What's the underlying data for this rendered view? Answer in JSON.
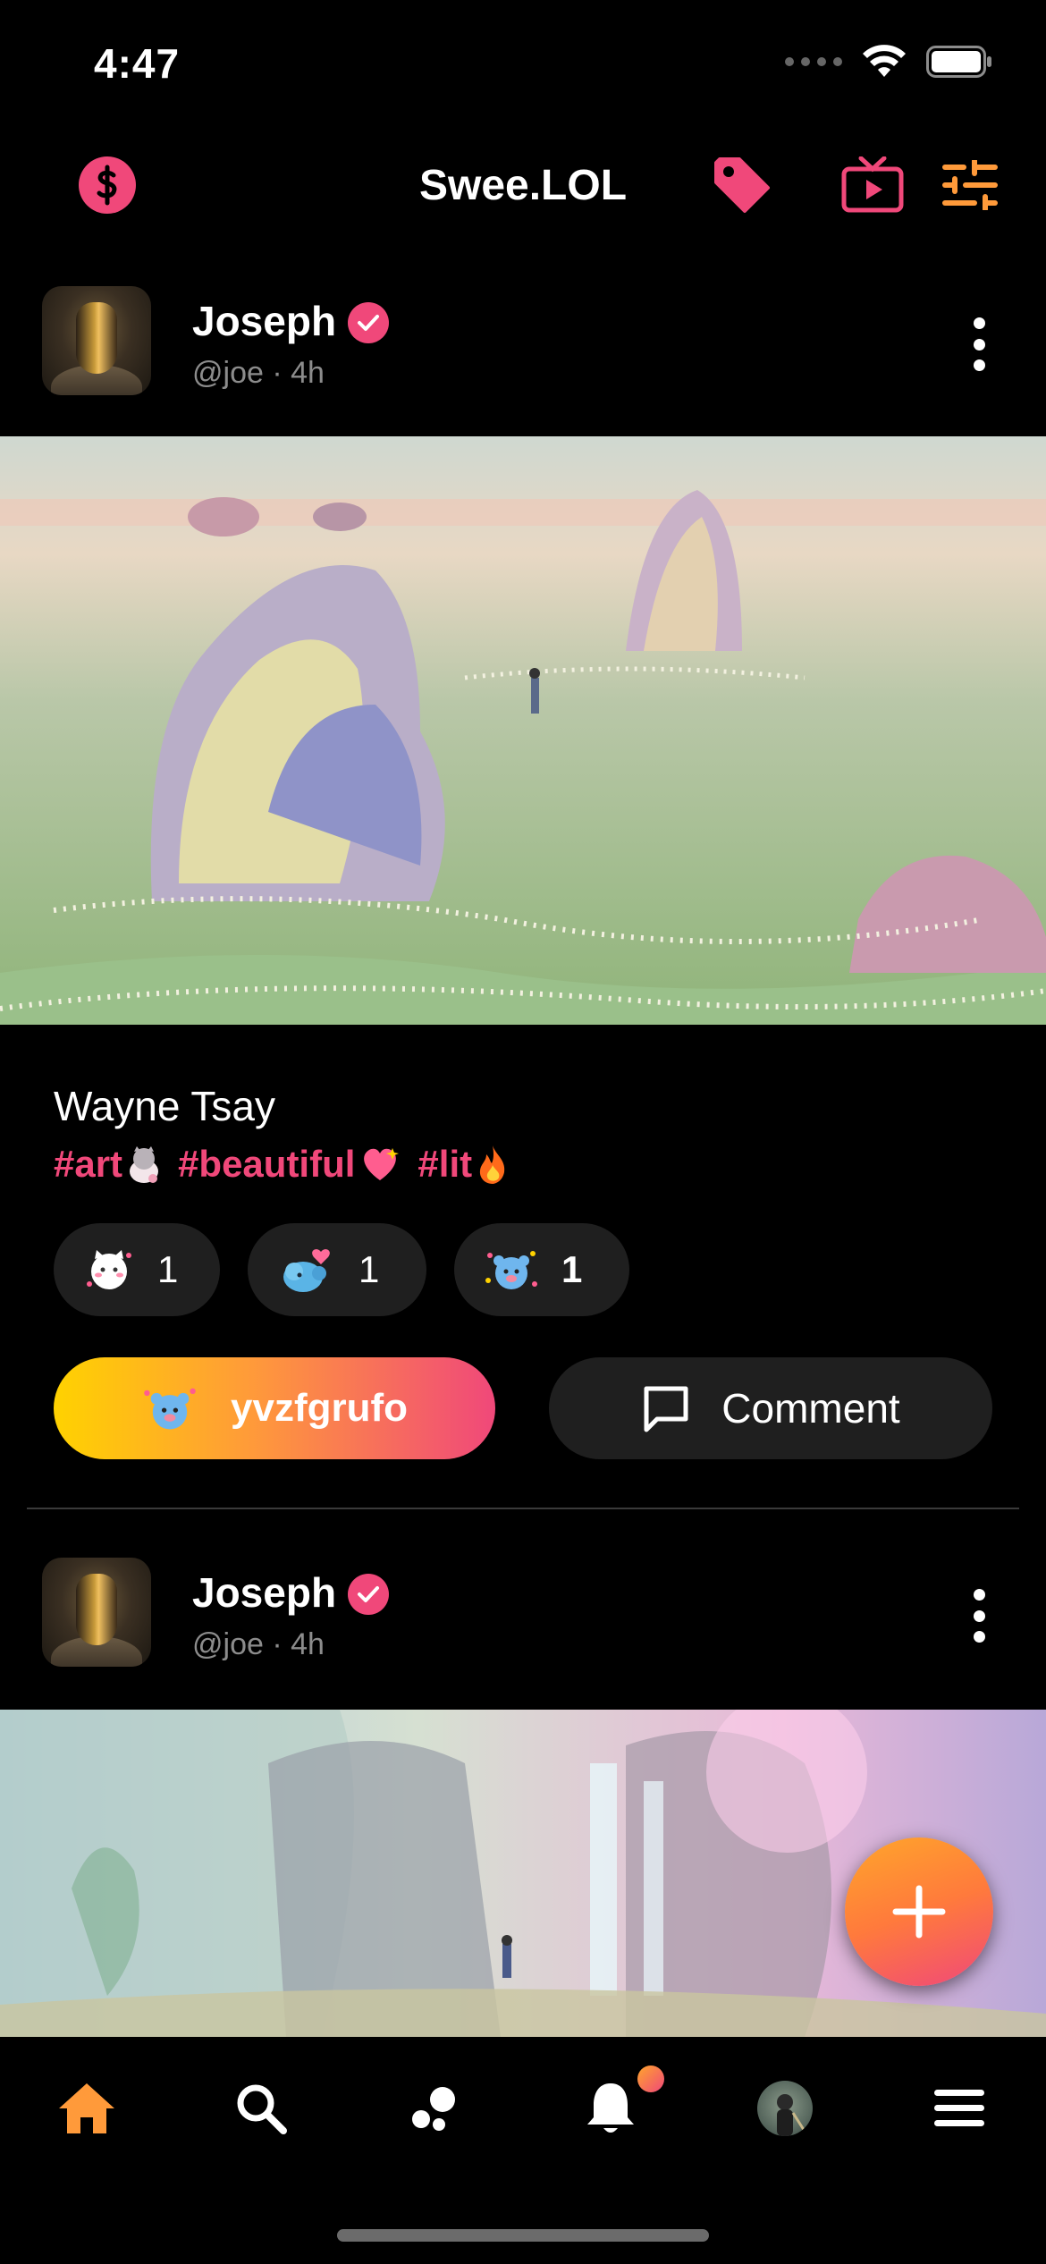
{
  "status_bar": {
    "time": "4:47"
  },
  "header": {
    "title": "Swee.LOL"
  },
  "posts": [
    {
      "author": "Joseph",
      "meta": "@joe · 4h",
      "caption_author": "Wayne Tsay",
      "hashtags": [
        "#art",
        "#beautiful",
        "#lit"
      ],
      "reactions": [
        {
          "icon": "cat-sticker-icon",
          "count": "1"
        },
        {
          "icon": "elephant-sticker-icon",
          "count": "1"
        },
        {
          "icon": "blue-bear-sticker-icon",
          "count": "1"
        }
      ],
      "react_button_label": "yvzfgrufo",
      "comment_button_label": "Comment"
    },
    {
      "author": "Joseph",
      "meta": "@joe · 4h"
    }
  ],
  "colors": {
    "accent_pink": "#f0487a",
    "accent_orange": "#ff9a3a",
    "accent_yellow": "#ffd200",
    "chip_bg": "#1f1f1f"
  },
  "tab_bar": {
    "items": [
      {
        "icon": "home-icon",
        "active": true
      },
      {
        "icon": "search-icon"
      },
      {
        "icon": "bubbles-icon"
      },
      {
        "icon": "bell-icon",
        "badge": true
      },
      {
        "icon": "profile-avatar-icon"
      },
      {
        "icon": "menu-icon"
      }
    ]
  }
}
